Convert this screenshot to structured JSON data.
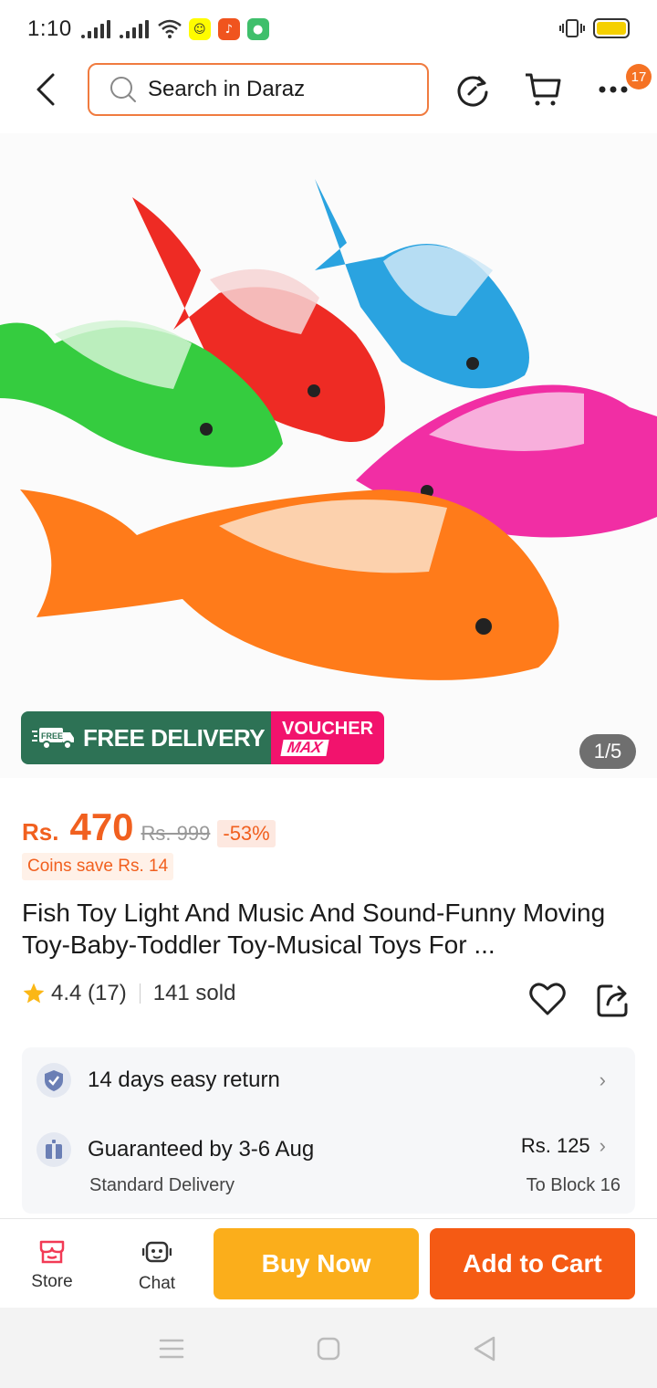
{
  "status_bar": {
    "time": "1:10"
  },
  "header": {
    "search_placeholder": "Search in Daraz",
    "more_badge_count": "17"
  },
  "gallery": {
    "promo_free_delivery": "FREE DELIVERY",
    "promo_free_tag": "FREE",
    "promo_voucher": "VOUCHER",
    "promo_max": "MAX",
    "image_counter": "1/5"
  },
  "product": {
    "currency": "Rs.",
    "price": "470",
    "original_price": "Rs. 999",
    "discount": "-53%",
    "coins_save": "Coins save Rs. 14",
    "title": "Fish Toy Light And Music And Sound-Funny Moving Toy-Baby-Toddler Toy-Musical Toys For ...",
    "rating": "4.4 (17)",
    "sold": "141 sold"
  },
  "service_card": {
    "return_label": "14 days easy return",
    "delivery_label": "Guaranteed by 3-6 Aug",
    "delivery_type": "Standard Delivery",
    "delivery_fee": "Rs. 125",
    "delivery_to": "To Block 16"
  },
  "bottom_bar": {
    "store_label": "Store",
    "chat_label": "Chat",
    "buy_now_label": "Buy Now",
    "add_to_cart_label": "Add to Cart"
  },
  "colors": {
    "brand_orange": "#f57224",
    "buy_now": "#fbae1b",
    "add_to_cart": "#f55a14",
    "free_delivery_green": "#2d7255",
    "voucher_pink": "#f2136d"
  }
}
